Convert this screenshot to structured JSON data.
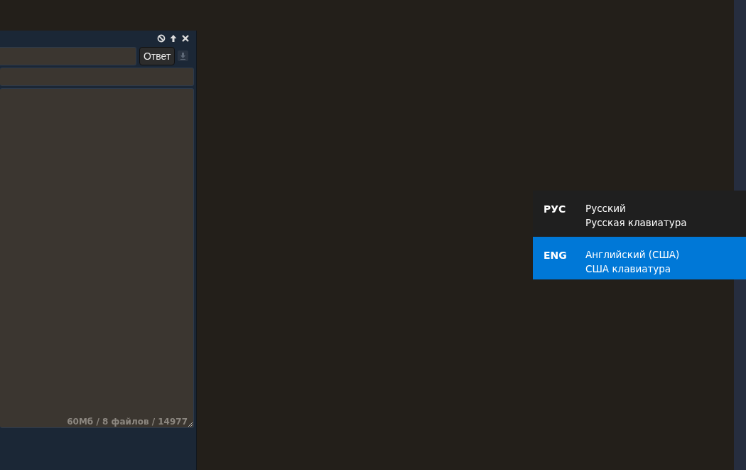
{
  "reply_form": {
    "submit_button": "Ответ",
    "textarea_status": "60Мб / 8 файлов / 14977"
  },
  "language_menu": {
    "items": [
      {
        "code": "РУС",
        "name": "Русский",
        "layout": "Русская клавиатура",
        "selected": false
      },
      {
        "code": "ENG",
        "name": "Английский (США)",
        "layout": "США клавиатура",
        "selected": true
      }
    ]
  }
}
